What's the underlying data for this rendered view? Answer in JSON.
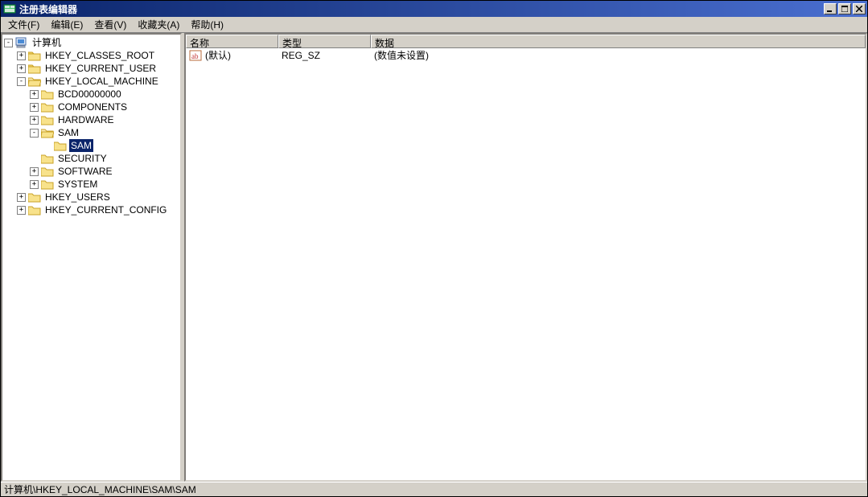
{
  "window": {
    "title": "注册表编辑器"
  },
  "menu": {
    "file": "文件(F)",
    "edit": "编辑(E)",
    "view": "查看(V)",
    "favorites": "收藏夹(A)",
    "help": "帮助(H)"
  },
  "tree": {
    "root": "计算机",
    "hkcr": "HKEY_CLASSES_ROOT",
    "hkcu": "HKEY_CURRENT_USER",
    "hklm": "HKEY_LOCAL_MACHINE",
    "hklm_children": {
      "bcd": "BCD00000000",
      "components": "COMPONENTS",
      "hardware": "HARDWARE",
      "sam": "SAM",
      "sam_child": "SAM",
      "security": "SECURITY",
      "software": "SOFTWARE",
      "system": "SYSTEM"
    },
    "hku": "HKEY_USERS",
    "hkcc": "HKEY_CURRENT_CONFIG"
  },
  "list": {
    "columns": {
      "name": "名称",
      "type": "类型",
      "data": "数据"
    },
    "rows": [
      {
        "name": "(默认)",
        "type": "REG_SZ",
        "data": "(数值未设置)"
      }
    ]
  },
  "statusbar": {
    "path": "计算机\\HKEY_LOCAL_MACHINE\\SAM\\SAM"
  }
}
